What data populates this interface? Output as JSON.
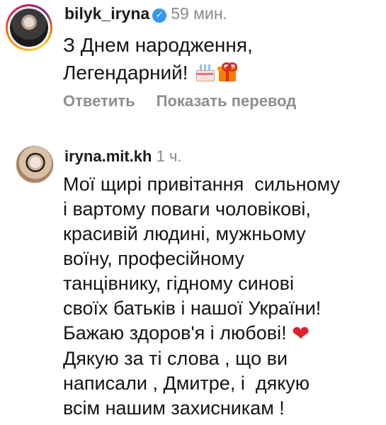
{
  "comments": [
    {
      "username": "bilyk_iryna",
      "verified": true,
      "time": "59 мин.",
      "text_lines": [
        "З Днем народження,",
        "Легендарний! "
      ],
      "emojis": [
        "birthday-cake-icon",
        "gift-icon"
      ],
      "actions": {
        "reply": "Ответить",
        "translate": "Показать перевод"
      }
    },
    {
      "username": "iryna.mit.kh",
      "time": "1 ч.",
      "text_lines": [
        "Мої щирі привітання  сильному",
        "і вартому поваги чоловікові,",
        "красивій людині, мужньому",
        "воїну, професійному",
        "танцівнику, гідному синові",
        "своїх батьків і нашої України!",
        "Бажаю здоров'я і любові! ",
        "Дякую за ті слова , що ви",
        "написали , Дмитре, і  дякую",
        "всім нашим захисникам !"
      ],
      "heart": "❤",
      "heart_color": "#e0202a"
    }
  ],
  "colors": {
    "verified": "#3897f0",
    "muted": "#8e8e8e"
  }
}
